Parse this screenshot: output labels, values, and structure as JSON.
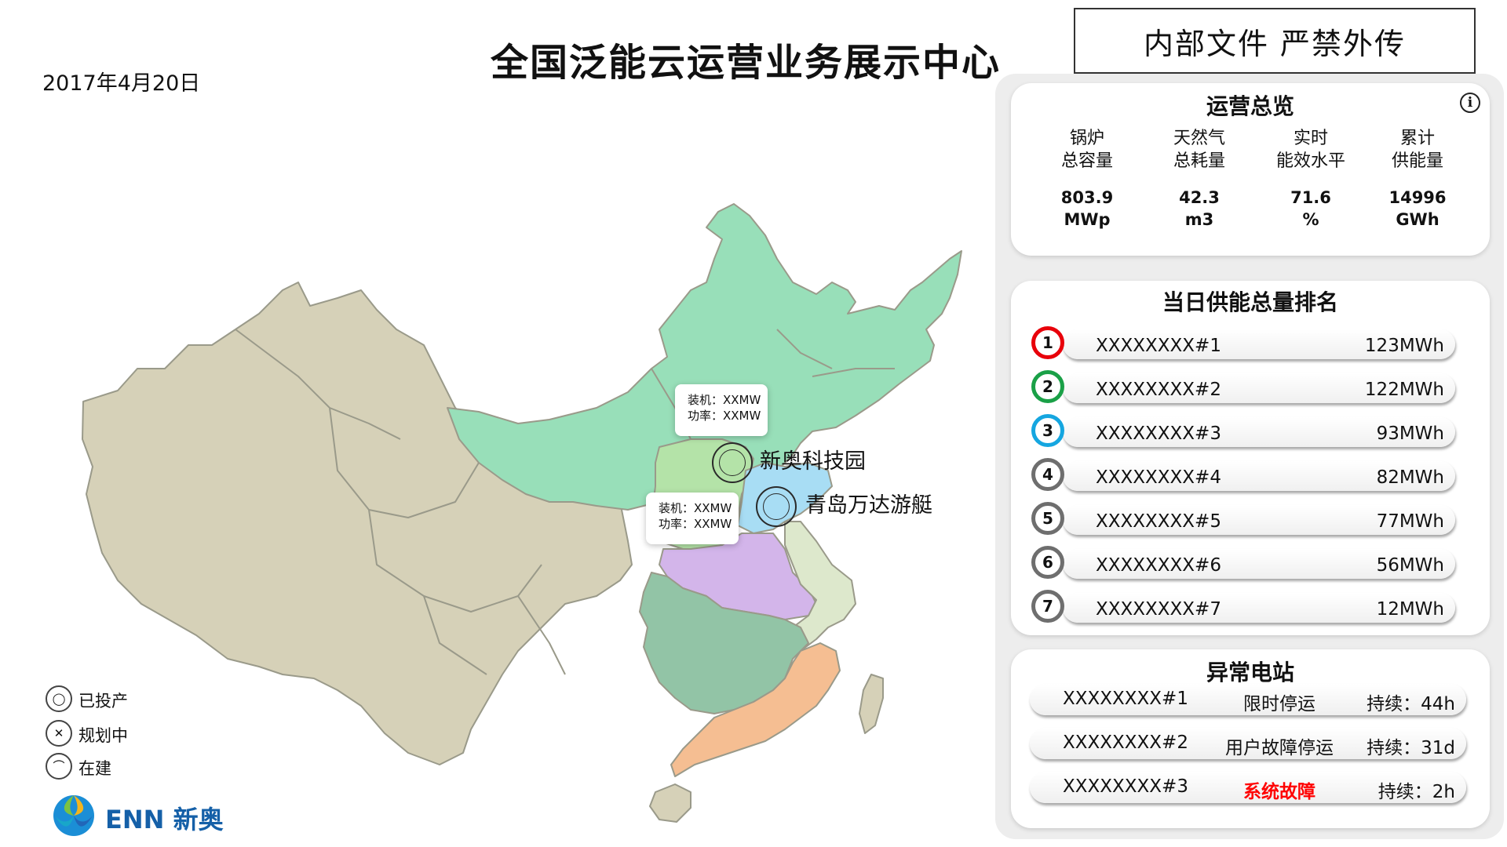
{
  "header": {
    "title": "全国泛能云运营业务展示中心",
    "date": "2017年4月20日",
    "confidential": "内部文件  严禁外传"
  },
  "overview": {
    "title": "运营总览",
    "info_icon": "info-icon",
    "metrics": [
      {
        "label1": "锅炉",
        "label2": "总容量",
        "value": "803.9",
        "unit": "MWp"
      },
      {
        "label1": "天然气",
        "label2": "总耗量",
        "value": "42.3",
        "unit": "m3"
      },
      {
        "label1": "实时",
        "label2": "能效水平",
        "value": "71.6",
        "unit": "%"
      },
      {
        "label1": "累计",
        "label2": "供能量",
        "value": "14996",
        "unit": "GWh"
      }
    ]
  },
  "ranking": {
    "title": "当日供能总量排名",
    "rows": [
      {
        "rank": "1",
        "name": "XXXXXXXX#1",
        "value": "123MWh",
        "color": "#e8000a"
      },
      {
        "rank": "2",
        "name": "XXXXXXXX#2",
        "value": "122MWh",
        "color": "#1aa047"
      },
      {
        "rank": "3",
        "name": "XXXXXXXX#3",
        "value": "93MWh",
        "color": "#15a6e0"
      },
      {
        "rank": "4",
        "name": "XXXXXXXX#4",
        "value": "82MWh",
        "color": "#6e6e6e"
      },
      {
        "rank": "5",
        "name": "XXXXXXXX#5",
        "value": "77MWh",
        "color": "#6e6e6e"
      },
      {
        "rank": "6",
        "name": "XXXXXXXX#6",
        "value": "56MWh",
        "color": "#6e6e6e"
      },
      {
        "rank": "7",
        "name": "XXXXXXXX#7",
        "value": "12MWh",
        "color": "#6e6e6e"
      }
    ]
  },
  "abnormal": {
    "title": "异常电站",
    "rows": [
      {
        "name": "XXXXXXXX#1",
        "status": "限时停运",
        "duration": "持续：44h",
        "alert": false
      },
      {
        "name": "XXXXXXXX#2",
        "status": "用户故障停运",
        "duration": "持续：31d",
        "alert": true
      },
      {
        "name": "XXXXXXXX#3",
        "status": "系统故障",
        "duration": "持续：2h",
        "alert": true
      }
    ],
    "alert_color": "#ff0000"
  },
  "map": {
    "stations": [
      {
        "name": "新奥科技园",
        "tooltip_line1": "装机：XXMW",
        "tooltip_line2": "功率：XXMW",
        "icon": "lightbulb-icon"
      },
      {
        "name": "青岛万达游艇",
        "tooltip_line1": "装机：XXMW",
        "tooltip_line2": "功率：XXMW",
        "icon": "lightbulb-icon"
      }
    ],
    "region_colors": {
      "base": "#d6d1b8",
      "northeast": "#98dfb9",
      "north": "#b4e3a8",
      "shandong": "#a8ddf4",
      "central": "#d3b5ea",
      "jiangsu": "#dde8cc",
      "south_central": "#92c4a6",
      "southeast": "#f5be92"
    }
  },
  "legend": [
    {
      "label": "已投产",
      "icon": "lightbulb-icon"
    },
    {
      "label": "规划中",
      "icon": "plan-icon"
    },
    {
      "label": "在建",
      "icon": "helmet-icon"
    }
  ],
  "logo": {
    "text": "ENN 新奥"
  }
}
